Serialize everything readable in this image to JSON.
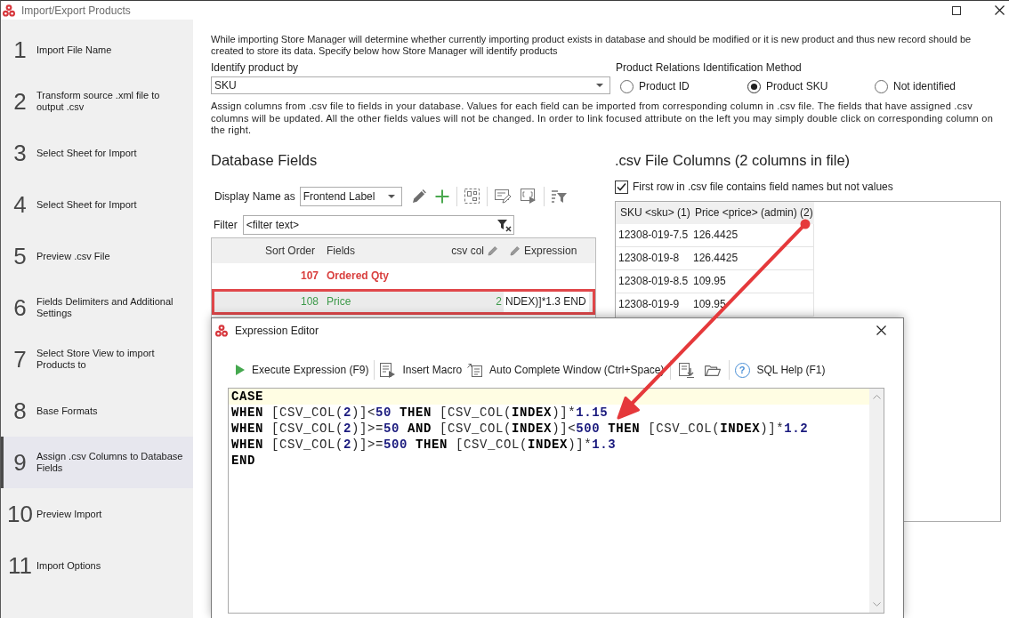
{
  "window": {
    "title": "Import/Export Products"
  },
  "steps": [
    {
      "number": "1",
      "label": "Import File Name",
      "selected": false
    },
    {
      "number": "2",
      "label": "Transform source .xml file to output .csv",
      "selected": false
    },
    {
      "number": "3",
      "label": "Select Sheet for Import",
      "selected": false
    },
    {
      "number": "4",
      "label": "Select Sheet for Import",
      "selected": false
    },
    {
      "number": "5",
      "label": "Preview .csv File",
      "selected": false
    },
    {
      "number": "6",
      "label": "Fields Delimiters and Additional Settings",
      "selected": false
    },
    {
      "number": "7",
      "label": "Select Store View to import Products to",
      "selected": false
    },
    {
      "number": "8",
      "label": "Base Formats",
      "selected": false
    },
    {
      "number": "9",
      "label": "Assign .csv Columns to Database Fields",
      "selected": true
    },
    {
      "number": "10",
      "label": "Preview Import",
      "selected": false
    },
    {
      "number": "11",
      "label": "Import Options",
      "selected": false
    }
  ],
  "intro_text": "While importing Store Manager will determine whether currently importing product exists in database and should be modified or it is new product and thus new record should be created to store its data. Specify below how Store Manager will identify products",
  "identify_product": {
    "label": "Identify product by",
    "value": "SKU"
  },
  "relation_method": {
    "label": "Product Relations Identification Method",
    "options": [
      {
        "label": "Product ID",
        "selected": false
      },
      {
        "label": "Product SKU",
        "selected": true
      },
      {
        "label": "Not identified",
        "selected": false
      }
    ]
  },
  "assign_text": "Assign columns from .csv file to fields in your database. Values for each field can be imported from corresponding column in .csv file. The fields that have assigned .csv columns will be updated. All the other fields values will not be changed. In order to link focused attribute on the left you may simply double click on corresponding column on the right.",
  "database_fields": {
    "title": "Database Fields",
    "display_name": {
      "label": "Display Name as",
      "value": "Frontend Label"
    },
    "tools": [
      {
        "kind": "edit"
      },
      {
        "kind": "add"
      },
      {
        "kind": "separator"
      },
      {
        "kind": "select"
      },
      {
        "kind": "separator"
      },
      {
        "kind": "note"
      },
      {
        "kind": "preview"
      },
      {
        "kind": "separator"
      },
      {
        "kind": "filter"
      }
    ],
    "filter": {
      "label": "Filter",
      "placeholder": "<filter text>"
    },
    "columns": [
      {
        "label": "Sort Order",
        "kind": "number",
        "editable": false
      },
      {
        "label": "Fields",
        "kind": "text",
        "editable": false
      },
      {
        "label": "csv col",
        "kind": "number",
        "editable": true
      },
      {
        "label": "Expression",
        "kind": "text",
        "editable": true
      }
    ],
    "rows": [
      {
        "sort_order": "107",
        "field": "Ordered Qty",
        "color": "#d9403f",
        "bold": true,
        "selected": false,
        "outlined": false
      },
      {
        "sort_order": "108",
        "field": "Price",
        "csv_col": "2",
        "expression": "NDEX)]*1.3 END",
        "color": "#3e9a4b",
        "bold": false,
        "selected": true,
        "outlined": true
      }
    ]
  },
  "csv_file": {
    "title": ".csv File Columns (2 columns in file)",
    "first_row_header": {
      "label": "First row in .csv file contains field names but not values",
      "checked": true
    },
    "columns": [
      "SKU <sku> (1)",
      "Price <price> (admin) (2)"
    ],
    "rows": [
      [
        "12308-019-7.5",
        "126.4425"
      ],
      [
        "12308-019-8",
        "126.4425"
      ],
      [
        "12308-019-8.5",
        "109.95"
      ],
      [
        "12308-019-9",
        "109.95"
      ]
    ]
  },
  "expression_editor": {
    "title": "Expression Editor",
    "toolbar": [
      {
        "kind": "execute",
        "label": "Execute Expression (F9)"
      },
      {
        "kind": "separator"
      },
      {
        "kind": "macro",
        "label": "Insert Macro"
      },
      {
        "kind": "autocomplete",
        "label": "Auto Complete Window (Ctrl+Space)"
      },
      {
        "kind": "separator"
      },
      {
        "kind": "download"
      },
      {
        "kind": "open"
      },
      {
        "kind": "separator"
      },
      {
        "kind": "help",
        "glyph": "?",
        "label": "SQL Help (F1)"
      }
    ],
    "lines": [
      {
        "current": true,
        "tokens": [
          {
            "kind": "keyword",
            "text": "CASE"
          }
        ]
      },
      {
        "current": false,
        "tokens": [
          {
            "kind": "keyword",
            "text": "WHEN"
          },
          {
            "kind": "plain",
            "text": " [CSV_COL("
          },
          {
            "kind": "number",
            "text": "2"
          },
          {
            "kind": "plain",
            "text": ")]<"
          },
          {
            "kind": "number",
            "text": "50"
          },
          {
            "kind": "keyword",
            "text": " THEN"
          },
          {
            "kind": "plain",
            "text": " [CSV_COL("
          },
          {
            "kind": "keyword",
            "text": "INDEX"
          },
          {
            "kind": "plain",
            "text": ")]*"
          },
          {
            "kind": "number",
            "text": "1.15"
          }
        ]
      },
      {
        "current": false,
        "tokens": [
          {
            "kind": "keyword",
            "text": "WHEN"
          },
          {
            "kind": "plain",
            "text": " [CSV_COL("
          },
          {
            "kind": "number",
            "text": "2"
          },
          {
            "kind": "plain",
            "text": ")]>="
          },
          {
            "kind": "number",
            "text": "50"
          },
          {
            "kind": "keyword",
            "text": " AND"
          },
          {
            "kind": "plain",
            "text": " [CSV_COL("
          },
          {
            "kind": "keyword",
            "text": "INDEX"
          },
          {
            "kind": "plain",
            "text": ")]<"
          },
          {
            "kind": "number",
            "text": "500"
          },
          {
            "kind": "keyword",
            "text": " THEN"
          },
          {
            "kind": "plain",
            "text": " [CSV_COL("
          },
          {
            "kind": "keyword",
            "text": "INDEX"
          },
          {
            "kind": "plain",
            "text": ")]*"
          },
          {
            "kind": "number",
            "text": "1.2"
          }
        ]
      },
      {
        "current": false,
        "tokens": [
          {
            "kind": "keyword",
            "text": "WHEN"
          },
          {
            "kind": "plain",
            "text": " [CSV_COL("
          },
          {
            "kind": "number",
            "text": "2"
          },
          {
            "kind": "plain",
            "text": ")]>="
          },
          {
            "kind": "number",
            "text": "500"
          },
          {
            "kind": "keyword",
            "text": " THEN"
          },
          {
            "kind": "plain",
            "text": " [CSV_COL("
          },
          {
            "kind": "keyword",
            "text": "INDEX"
          },
          {
            "kind": "plain",
            "text": ")]*"
          },
          {
            "kind": "number",
            "text": "1.3"
          }
        ]
      },
      {
        "current": false,
        "tokens": [
          {
            "kind": "keyword",
            "text": "END"
          }
        ]
      }
    ]
  }
}
